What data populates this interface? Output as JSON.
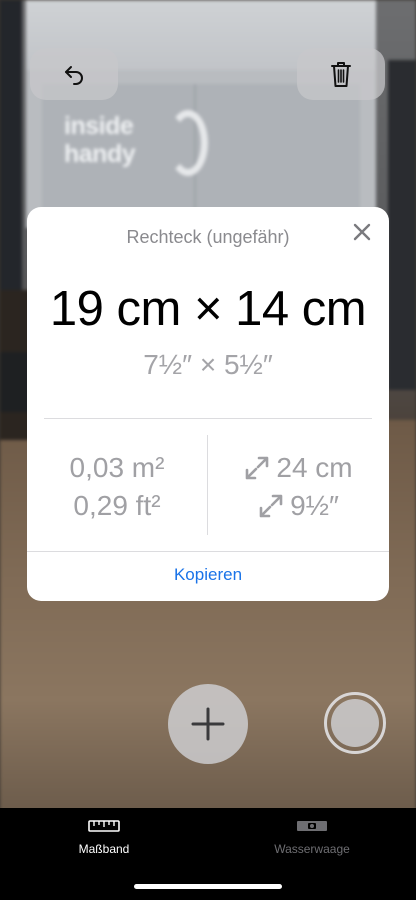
{
  "background": {
    "brand_text": "inside handy"
  },
  "toolbar": {
    "undo_icon": "undo-arrow-icon",
    "trash_icon": "trash-icon"
  },
  "card": {
    "title": "Rechteck (ungefähr)",
    "close_icon": "close-icon",
    "dimensions_metric": "19 cm × 14 cm",
    "dimensions_imperial": "7½″ × 5½″",
    "area_metric": "0,03 m²",
    "area_imperial": "0,29 ft²",
    "diagonal_metric": "24 cm",
    "diagonal_imperial": "9½″",
    "diagonal_icon": "diagonal-expand-icon",
    "copy_label": "Kopieren",
    "accent_color": "#1a73e8"
  },
  "controls": {
    "add_icon": "plus-icon",
    "capture_icon": "shutter-icon"
  },
  "tabbar": {
    "tabs": [
      {
        "label": "Maßband",
        "icon": "ruler-icon",
        "active": true
      },
      {
        "label": "Wasserwaage",
        "icon": "level-icon",
        "active": false
      }
    ]
  }
}
